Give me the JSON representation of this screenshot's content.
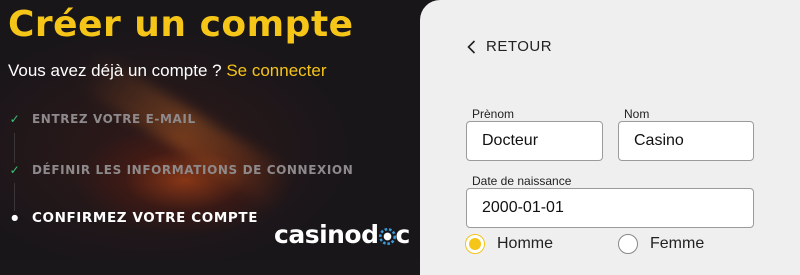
{
  "left": {
    "title": "Créer un compte",
    "subtitle_text": "Vous avez déjà un compte ? ",
    "login_link": "Se connecter",
    "steps": [
      {
        "label": "Entrez votre e-mail",
        "state": "done"
      },
      {
        "label": "Définir les informations de connexion",
        "state": "done"
      },
      {
        "label": "Confirmez votre compte",
        "state": "active"
      }
    ],
    "logo_text_a": "casino",
    "logo_text_b": "d",
    "logo_text_c": "c"
  },
  "form": {
    "back_label": "RETOUR",
    "firstname_label": "Prènom",
    "firstname_value": "Docteur",
    "lastname_label": "Nom",
    "lastname_value": "Casino",
    "birthdate_label": "Date de naissance",
    "birthdate_value": "2000-01-01",
    "gender_options": [
      {
        "label": "Homme",
        "selected": true
      },
      {
        "label": "Femme",
        "selected": false
      }
    ]
  },
  "colors": {
    "accent": "#f5c518",
    "check": "#3ec27a",
    "panel": "#efefef",
    "dark_bg": "#19161a"
  }
}
